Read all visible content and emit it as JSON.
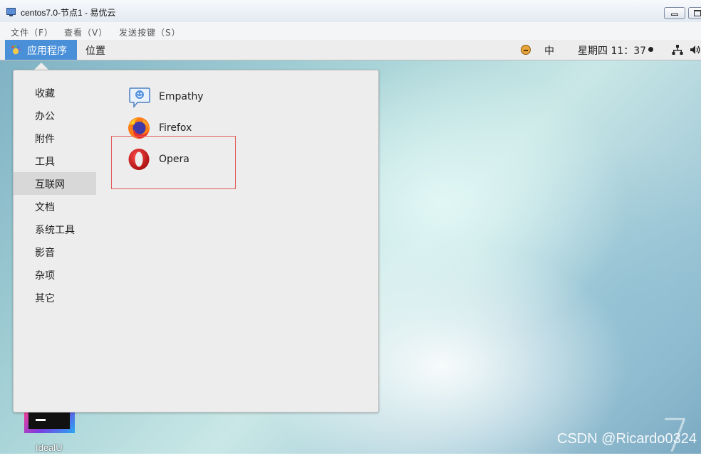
{
  "window": {
    "title": "centos7.0-节点1 - 易优云"
  },
  "menubar": {
    "items": [
      "文件（F）",
      "查看（V）",
      "发送按键（S）"
    ]
  },
  "panel": {
    "applications_label": "应用程序",
    "places_label": "位置",
    "input_method": "中",
    "clock": "星期四 11：37",
    "icons": [
      "gnome-foot-icon",
      "user-face-icon",
      "network-icon",
      "volume-icon"
    ]
  },
  "app_menu": {
    "categories": [
      "收藏",
      "办公",
      "附件",
      "工具",
      "互联网",
      "文档",
      "系统工具",
      "影音",
      "杂项",
      "其它"
    ],
    "selected_category": "互联网",
    "apps": [
      {
        "name": "Empathy",
        "icon": "empathy-chat-icon"
      },
      {
        "name": "Firefox",
        "icon": "firefox-icon"
      },
      {
        "name": "Opera",
        "icon": "opera-icon"
      }
    ],
    "highlight_color": "#e25b5b"
  },
  "desktop": {
    "launcher_label": "IdealU",
    "watermark": "CSDN @Ricardo0324",
    "version_mark": "7"
  },
  "colors": {
    "panel_accent": "#4a90d9",
    "menu_bg": "#ededed",
    "selected_bg": "#d8d8d8"
  }
}
